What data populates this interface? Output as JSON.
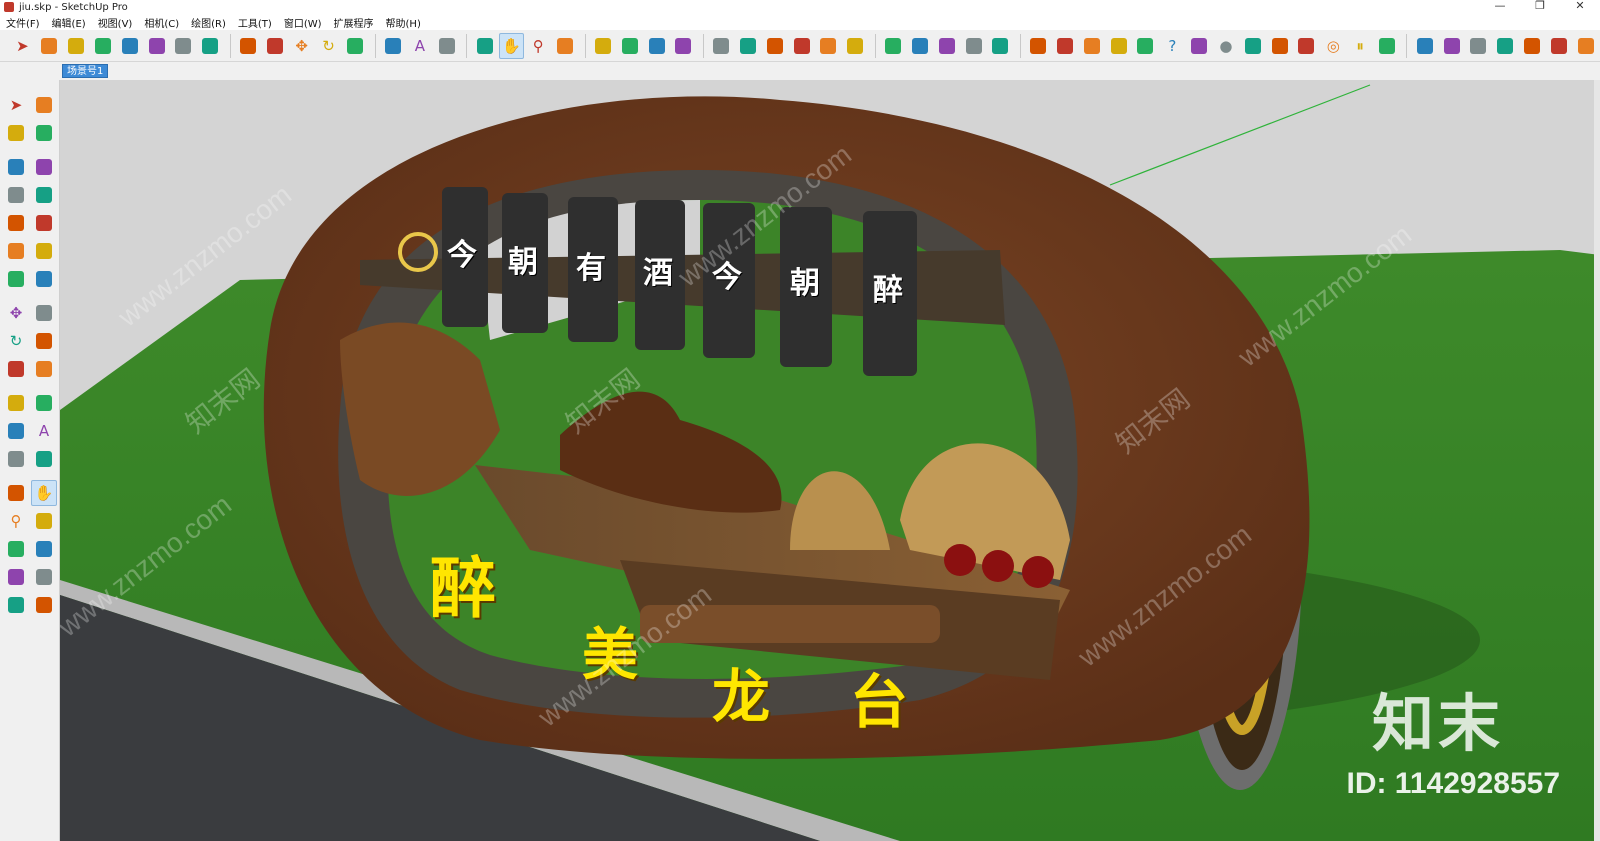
{
  "window": {
    "title": "jiu.skp - SketchUp Pro",
    "controls": [
      "—",
      "❐",
      "✕"
    ]
  },
  "menu": [
    "文件(F)",
    "编辑(E)",
    "视图(V)",
    "相机(C)",
    "绘图(R)",
    "工具(T)",
    "窗口(W)",
    "扩展程序",
    "帮助(H)"
  ],
  "scene": {
    "tab_label": "场景号1"
  },
  "toolbar_icons": [
    "select-icon",
    "eraser-icon",
    "pencil-icon",
    "line-dropdown-icon",
    "arc-icon",
    "arc-dropdown-icon",
    "rectangle-icon",
    "rectangle-dropdown-icon",
    "push-pull-icon",
    "follow-me-icon",
    "move-icon",
    "rotate-icon",
    "scale-icon",
    "tape-measure-icon",
    "text-icon",
    "paint-bucket-icon",
    "orbit-icon",
    "pan-icon",
    "zoom-icon",
    "zoom-extents-icon",
    "warehouse-icon",
    "share-model-icon",
    "extension-warehouse-icon",
    "layout-icon",
    "iso-view-icon",
    "top-view-icon",
    "front-view-icon",
    "right-view-icon",
    "back-view-icon",
    "left-view-icon",
    "xray-icon",
    "wireframe-icon",
    "hidden-line-icon",
    "shaded-icon",
    "textured-icon",
    "plugin-m-icon",
    "plugin-tag-icon",
    "plugin-r-icon",
    "plugin-rt-icon",
    "plugin-br-icon",
    "help-icon",
    "plugin-key-icon",
    "sphere-icon",
    "plugin-wand-icon",
    "plugin-tree-icon",
    "plugin-tree2-icon",
    "target-icon",
    "pause-icon",
    "color-wheel-icon",
    "section-plane-icon",
    "section-display-icon",
    "sandbox-icon",
    "sandbox2-icon",
    "stamp-icon",
    "drape-icon",
    "add-detail-icon"
  ],
  "left_tools": [
    [
      "select-icon",
      "make-component-icon"
    ],
    [
      "paint-bucket-icon",
      "eraser-icon"
    ],
    [
      "pencil-icon",
      "freehand-icon"
    ],
    [
      "rectangle-icon",
      "rotated-rectangle-icon"
    ],
    [
      "circle-icon",
      "polygon-icon"
    ],
    [
      "arc-icon",
      "two-point-arc-icon"
    ],
    [
      "three-point-arc-icon",
      "pie-icon"
    ],
    [
      "move-icon",
      "push-pull-icon"
    ],
    [
      "rotate-icon",
      "follow-me-icon"
    ],
    [
      "scale-icon",
      "offset-icon"
    ],
    [
      "tape-measure-icon",
      "dimension-icon"
    ],
    [
      "protractor-icon",
      "text-icon"
    ],
    [
      "axes-icon",
      "3d-text-icon"
    ],
    [
      "orbit-icon",
      "pan-icon"
    ],
    [
      "zoom-icon",
      "zoom-window-icon"
    ],
    [
      "zoom-extents-icon",
      "previous-view-icon"
    ],
    [
      "position-camera-icon",
      "look-around-icon"
    ],
    [
      "walk-icon",
      "section-plane-icon"
    ]
  ],
  "scene_text": {
    "plank_chars": [
      "今",
      "朝",
      "有",
      "酒",
      "今",
      "朝",
      "醉"
    ],
    "gold_title": [
      "醉",
      "美",
      "龙",
      "台"
    ]
  },
  "watermark": {
    "brand": "知末",
    "id": "ID: 1142928557",
    "site": "www.znzmo.com",
    "site_cn": "知末网"
  },
  "colors": {
    "sky": "#d6d6d6",
    "grass": "#3f8a2c",
    "road": "#3b3d40",
    "barrel": "#6b3a1e",
    "gold": "#ffe600",
    "accent": "#3d8ad6"
  }
}
